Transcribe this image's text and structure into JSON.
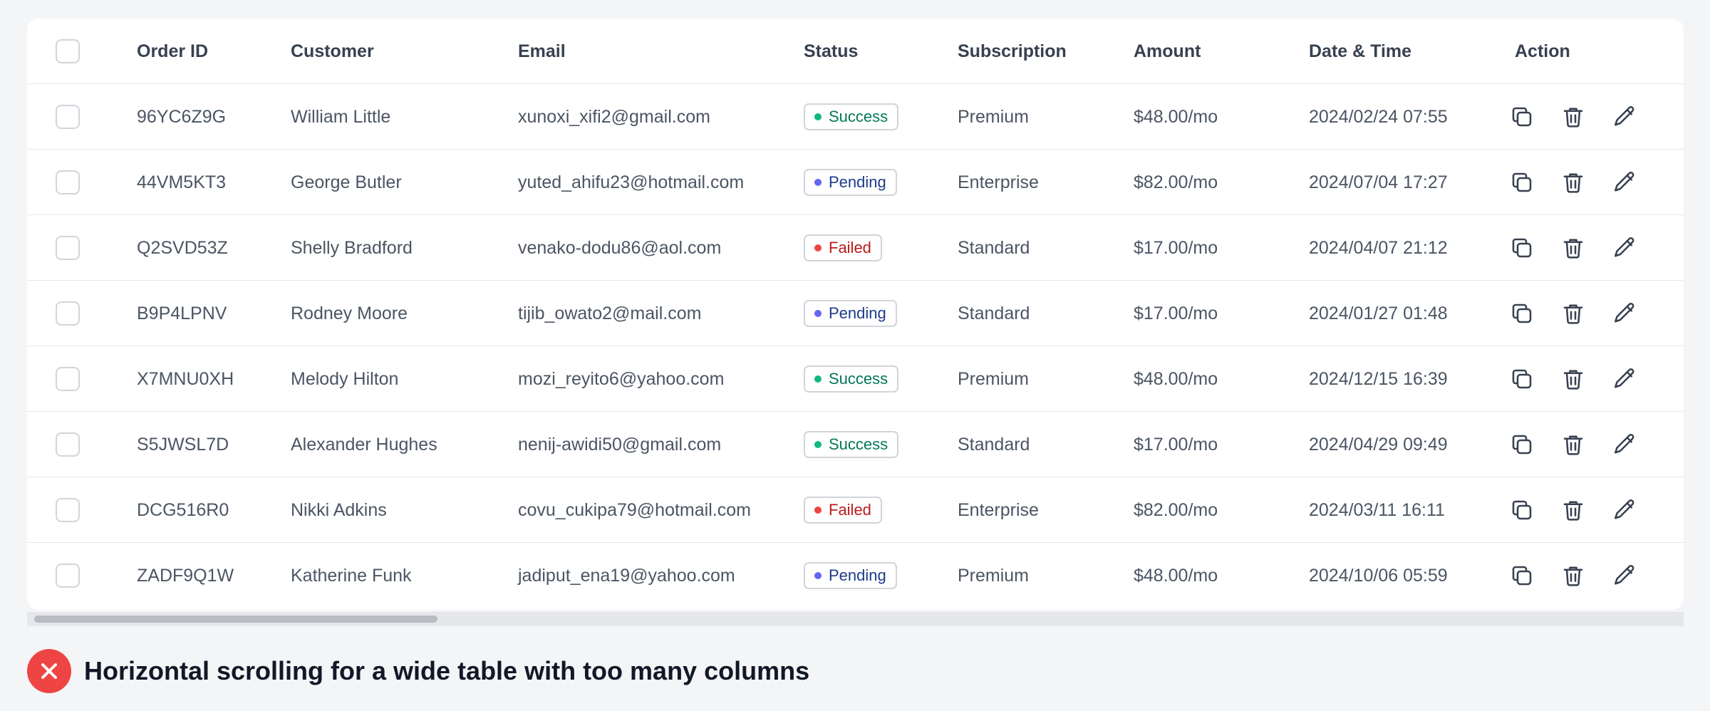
{
  "table": {
    "columns": {
      "order_id": "Order ID",
      "customer": "Customer",
      "email": "Email",
      "status": "Status",
      "subscription": "Subscription",
      "amount": "Amount",
      "datetime": "Date & Time",
      "action": "Action"
    },
    "rows": [
      {
        "order_id": "96YC6Z9G",
        "customer": "William Little",
        "email": "xunoxi_xifi2@gmail.com",
        "status": "Success",
        "status_kind": "success",
        "subscription": "Premium",
        "amount": "$48.00/mo",
        "datetime": "2024/02/24 07:55"
      },
      {
        "order_id": "44VM5KT3",
        "customer": "George Butler",
        "email": "yuted_ahifu23@hotmail.com",
        "status": "Pending",
        "status_kind": "pending",
        "subscription": "Enterprise",
        "amount": "$82.00/mo",
        "datetime": "2024/07/04 17:27"
      },
      {
        "order_id": "Q2SVD53Z",
        "customer": "Shelly Bradford",
        "email": "venako-dodu86@aol.com",
        "status": "Failed",
        "status_kind": "failed",
        "subscription": "Standard",
        "amount": "$17.00/mo",
        "datetime": "2024/04/07 21:12"
      },
      {
        "order_id": "B9P4LPNV",
        "customer": "Rodney Moore",
        "email": "tijib_owato2@mail.com",
        "status": "Pending",
        "status_kind": "pending",
        "subscription": "Standard",
        "amount": "$17.00/mo",
        "datetime": "2024/01/27 01:48"
      },
      {
        "order_id": "X7MNU0XH",
        "customer": "Melody Hilton",
        "email": "mozi_reyito6@yahoo.com",
        "status": "Success",
        "status_kind": "success",
        "subscription": "Premium",
        "amount": "$48.00/mo",
        "datetime": "2024/12/15 16:39"
      },
      {
        "order_id": "S5JWSL7D",
        "customer": "Alexander Hughes",
        "email": "nenij-awidi50@gmail.com",
        "status": "Success",
        "status_kind": "success",
        "subscription": "Standard",
        "amount": "$17.00/mo",
        "datetime": "2024/04/29 09:49"
      },
      {
        "order_id": "DCG516R0",
        "customer": "Nikki Adkins",
        "email": "covu_cukipa79@hotmail.com",
        "status": "Failed",
        "status_kind": "failed",
        "subscription": "Enterprise",
        "amount": "$82.00/mo",
        "datetime": "2024/03/11 16:11"
      },
      {
        "order_id": "ZADF9Q1W",
        "customer": "Katherine Funk",
        "email": "jadiput_ena19@yahoo.com",
        "status": "Pending",
        "status_kind": "pending",
        "subscription": "Premium",
        "amount": "$48.00/mo",
        "datetime": "2024/10/06 05:59"
      }
    ],
    "action_icons": [
      "copy-icon",
      "trash-icon",
      "pencil-icon"
    ]
  },
  "scrollbar": {
    "position": 0
  },
  "caption": {
    "icon": "x-circle-icon",
    "text": "Horizontal scrolling for a wide table with too many columns"
  },
  "colors": {
    "success": "#10b981",
    "pending": "#6366f1",
    "failed": "#ef4444"
  }
}
